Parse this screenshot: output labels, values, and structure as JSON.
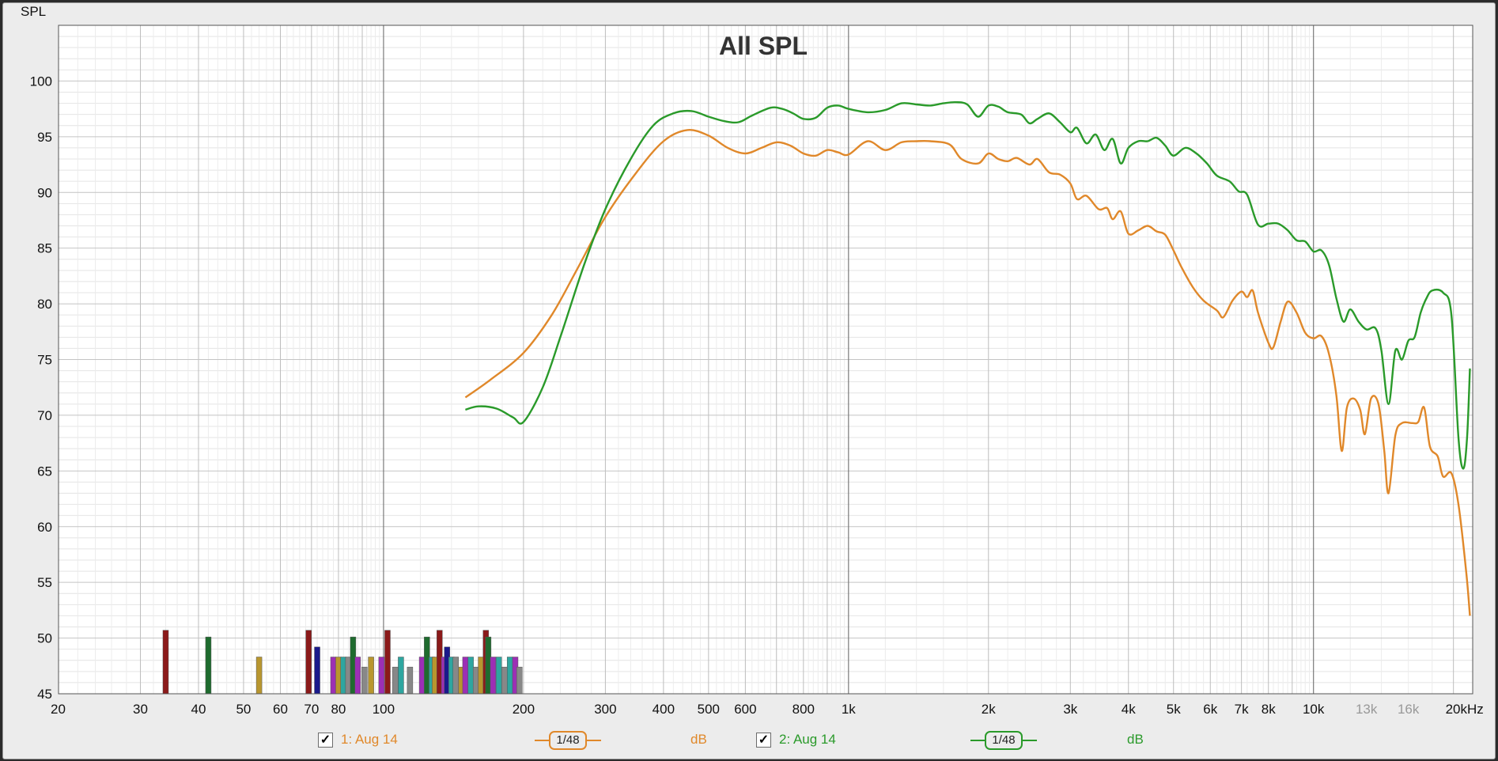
{
  "chart_data": {
    "type": "line",
    "title": "All SPL",
    "ylabel": "SPL",
    "xlabel": "",
    "xscale": "log",
    "xlim": [
      20,
      22000
    ],
    "ylim": [
      45,
      105
    ],
    "grid": true,
    "y_ticks": [
      45,
      50,
      55,
      60,
      65,
      70,
      75,
      80,
      85,
      90,
      95,
      100
    ],
    "x_ticks": [
      {
        "v": 20,
        "label": "20"
      },
      {
        "v": 30,
        "label": "30"
      },
      {
        "v": 40,
        "label": "40"
      },
      {
        "v": 50,
        "label": "50"
      },
      {
        "v": 60,
        "label": "60"
      },
      {
        "v": 70,
        "label": "70"
      },
      {
        "v": 80,
        "label": "80"
      },
      {
        "v": 100,
        "label": "100"
      },
      {
        "v": 200,
        "label": "200"
      },
      {
        "v": 300,
        "label": "300"
      },
      {
        "v": 400,
        "label": "400"
      },
      {
        "v": 500,
        "label": "500"
      },
      {
        "v": 600,
        "label": "600"
      },
      {
        "v": 800,
        "label": "800"
      },
      {
        "v": 1000,
        "label": "1k"
      },
      {
        "v": 2000,
        "label": "2k"
      },
      {
        "v": 3000,
        "label": "3k"
      },
      {
        "v": 4000,
        "label": "4k"
      },
      {
        "v": 5000,
        "label": "5k"
      },
      {
        "v": 6000,
        "label": "6k"
      },
      {
        "v": 7000,
        "label": "7k"
      },
      {
        "v": 8000,
        "label": "8k"
      },
      {
        "v": 10000,
        "label": "10k"
      },
      {
        "v": 13000,
        "label": "13k",
        "muted": true
      },
      {
        "v": 16000,
        "label": "16k",
        "muted": true
      },
      {
        "v": 20000,
        "label": "20kHz"
      }
    ],
    "series": [
      {
        "name": "1: Aug 14",
        "color": "#e0882a",
        "points": [
          [
            150,
            71.6
          ],
          [
            170,
            73.2
          ],
          [
            200,
            75.6
          ],
          [
            230,
            79
          ],
          [
            260,
            83
          ],
          [
            300,
            87.8
          ],
          [
            350,
            91.8
          ],
          [
            400,
            94.6
          ],
          [
            450,
            95.6
          ],
          [
            500,
            95.1
          ],
          [
            550,
            94
          ],
          [
            600,
            93.5
          ],
          [
            650,
            94
          ],
          [
            700,
            94.5
          ],
          [
            750,
            94.2
          ],
          [
            800,
            93.5
          ],
          [
            850,
            93.3
          ],
          [
            900,
            93.8
          ],
          [
            950,
            93.6
          ],
          [
            1000,
            93.4
          ],
          [
            1100,
            94.6
          ],
          [
            1200,
            93.8
          ],
          [
            1300,
            94.5
          ],
          [
            1400,
            94.6
          ],
          [
            1500,
            94.6
          ],
          [
            1650,
            94.3
          ],
          [
            1750,
            93
          ],
          [
            1900,
            92.6
          ],
          [
            2000,
            93.5
          ],
          [
            2100,
            93
          ],
          [
            2200,
            92.8
          ],
          [
            2300,
            93.1
          ],
          [
            2450,
            92.5
          ],
          [
            2550,
            93
          ],
          [
            2700,
            91.8
          ],
          [
            2850,
            91.6
          ],
          [
            3000,
            90.8
          ],
          [
            3100,
            89.4
          ],
          [
            3250,
            89.7
          ],
          [
            3450,
            88.5
          ],
          [
            3600,
            88.6
          ],
          [
            3700,
            87.6
          ],
          [
            3850,
            88.3
          ],
          [
            4000,
            86.3
          ],
          [
            4200,
            86.6
          ],
          [
            4400,
            87
          ],
          [
            4600,
            86.5
          ],
          [
            4800,
            86.2
          ],
          [
            5000,
            84.8
          ],
          [
            5200,
            83.3
          ],
          [
            5500,
            81.5
          ],
          [
            5800,
            80.3
          ],
          [
            6200,
            79.4
          ],
          [
            6400,
            78.8
          ],
          [
            6700,
            80.3
          ],
          [
            7000,
            81.1
          ],
          [
            7200,
            80.6
          ],
          [
            7400,
            81.2
          ],
          [
            7600,
            79.2
          ],
          [
            8000,
            76.5
          ],
          [
            8200,
            76.1
          ],
          [
            8500,
            78.4
          ],
          [
            8800,
            80.2
          ],
          [
            9200,
            79.2
          ],
          [
            9600,
            77.4
          ],
          [
            10000,
            76.9
          ],
          [
            10400,
            77.1
          ],
          [
            10800,
            75.5
          ],
          [
            11200,
            71.8
          ],
          [
            11500,
            66.8
          ],
          [
            11800,
            70.7
          ],
          [
            12200,
            71.5
          ],
          [
            12600,
            70.5
          ],
          [
            12900,
            68.3
          ],
          [
            13300,
            71.5
          ],
          [
            13800,
            71
          ],
          [
            14200,
            66.8
          ],
          [
            14500,
            63
          ],
          [
            15000,
            68.2
          ],
          [
            15500,
            69.3
          ],
          [
            16300,
            69.3
          ],
          [
            16800,
            69.4
          ],
          [
            17300,
            70.7
          ],
          [
            17800,
            67.2
          ],
          [
            18500,
            66.3
          ],
          [
            19000,
            64.5
          ],
          [
            19800,
            64.8
          ],
          [
            20500,
            62
          ],
          [
            21300,
            56
          ],
          [
            21700,
            52
          ]
        ]
      },
      {
        "name": "2: Aug 14",
        "color": "#2a9a2a",
        "points": [
          [
            150,
            70.5
          ],
          [
            160,
            70.8
          ],
          [
            175,
            70.6
          ],
          [
            190,
            69.8
          ],
          [
            200,
            69.4
          ],
          [
            220,
            72.5
          ],
          [
            240,
            77
          ],
          [
            270,
            83.5
          ],
          [
            300,
            88.5
          ],
          [
            340,
            93
          ],
          [
            380,
            96
          ],
          [
            420,
            97.1
          ],
          [
            460,
            97.3
          ],
          [
            500,
            96.8
          ],
          [
            540,
            96.4
          ],
          [
            580,
            96.3
          ],
          [
            620,
            96.9
          ],
          [
            680,
            97.6
          ],
          [
            720,
            97.5
          ],
          [
            760,
            97.1
          ],
          [
            800,
            96.6
          ],
          [
            850,
            96.7
          ],
          [
            900,
            97.6
          ],
          [
            950,
            97.8
          ],
          [
            1000,
            97.5
          ],
          [
            1100,
            97.2
          ],
          [
            1200,
            97.4
          ],
          [
            1300,
            98
          ],
          [
            1400,
            97.9
          ],
          [
            1500,
            97.8
          ],
          [
            1600,
            98
          ],
          [
            1700,
            98.1
          ],
          [
            1800,
            97.9
          ],
          [
            1900,
            96.8
          ],
          [
            2000,
            97.8
          ],
          [
            2100,
            97.7
          ],
          [
            2200,
            97.2
          ],
          [
            2350,
            97
          ],
          [
            2450,
            96.2
          ],
          [
            2550,
            96.6
          ],
          [
            2700,
            97.1
          ],
          [
            2850,
            96.3
          ],
          [
            3000,
            95.4
          ],
          [
            3100,
            95.8
          ],
          [
            3250,
            94.4
          ],
          [
            3400,
            95.2
          ],
          [
            3550,
            93.8
          ],
          [
            3700,
            94.8
          ],
          [
            3850,
            92.6
          ],
          [
            4000,
            94
          ],
          [
            4200,
            94.6
          ],
          [
            4400,
            94.6
          ],
          [
            4600,
            94.9
          ],
          [
            4800,
            94.2
          ],
          [
            5000,
            93.3
          ],
          [
            5300,
            94
          ],
          [
            5600,
            93.5
          ],
          [
            5900,
            92.6
          ],
          [
            6200,
            91.5
          ],
          [
            6600,
            91
          ],
          [
            6900,
            90.1
          ],
          [
            7200,
            89.8
          ],
          [
            7600,
            87.1
          ],
          [
            8000,
            87.2
          ],
          [
            8400,
            87.2
          ],
          [
            8800,
            86.6
          ],
          [
            9200,
            85.7
          ],
          [
            9600,
            85.6
          ],
          [
            10000,
            84.7
          ],
          [
            10400,
            84.8
          ],
          [
            10800,
            83.5
          ],
          [
            11200,
            80.5
          ],
          [
            11600,
            78.4
          ],
          [
            12000,
            79.5
          ],
          [
            12500,
            78.4
          ],
          [
            13000,
            77.7
          ],
          [
            13600,
            77.8
          ],
          [
            14000,
            75.8
          ],
          [
            14500,
            71
          ],
          [
            15000,
            75.8
          ],
          [
            15500,
            75
          ],
          [
            16000,
            76.7
          ],
          [
            16500,
            77
          ],
          [
            17000,
            79.2
          ],
          [
            17500,
            80.5
          ],
          [
            18000,
            81.2
          ],
          [
            19000,
            81
          ],
          [
            19800,
            79
          ],
          [
            20500,
            68
          ],
          [
            21000,
            65.2
          ],
          [
            21400,
            68
          ],
          [
            21700,
            74.2
          ]
        ]
      }
    ],
    "bars": [
      {
        "f": 34,
        "v": 50.7,
        "color": "#8b1a1a"
      },
      {
        "f": 42,
        "v": 50.1,
        "color": "#1e6b2e"
      },
      {
        "f": 54,
        "v": 48.3,
        "color": "#b8962e"
      },
      {
        "f": 69,
        "v": 50.7,
        "color": "#8b1a1a"
      },
      {
        "f": 72,
        "v": 49.2,
        "color": "#1a1a8b"
      },
      {
        "f": 78,
        "v": 48.3,
        "color": "#9c2fb5"
      },
      {
        "f": 80,
        "v": 48.3,
        "color": "#b8962e"
      },
      {
        "f": 82,
        "v": 48.3,
        "color": "#2ea6a0"
      },
      {
        "f": 84,
        "v": 48.3,
        "color": "#888888"
      },
      {
        "f": 86,
        "v": 50.1,
        "color": "#1e6b2e"
      },
      {
        "f": 88,
        "v": 48.3,
        "color": "#9c2fb5"
      },
      {
        "f": 91,
        "v": 47.4,
        "color": "#888888"
      },
      {
        "f": 94,
        "v": 48.3,
        "color": "#b8962e"
      },
      {
        "f": 99,
        "v": 48.3,
        "color": "#9c2fb5"
      },
      {
        "f": 102,
        "v": 50.7,
        "color": "#8b1a1a"
      },
      {
        "f": 106,
        "v": 47.4,
        "color": "#888888"
      },
      {
        "f": 109,
        "v": 48.3,
        "color": "#2ea6a0"
      },
      {
        "f": 114,
        "v": 47.4,
        "color": "#888888"
      },
      {
        "f": 121,
        "v": 48.3,
        "color": "#9c2fb5"
      },
      {
        "f": 124,
        "v": 50.1,
        "color": "#1e6b2e"
      },
      {
        "f": 127,
        "v": 48.3,
        "color": "#2ea6a0"
      },
      {
        "f": 129,
        "v": 48.3,
        "color": "#b8962e"
      },
      {
        "f": 132,
        "v": 50.7,
        "color": "#8b1a1a"
      },
      {
        "f": 135,
        "v": 48.3,
        "color": "#9c2fb5"
      },
      {
        "f": 137,
        "v": 49.2,
        "color": "#1a1a8b"
      },
      {
        "f": 140,
        "v": 48.3,
        "color": "#2ea6a0"
      },
      {
        "f": 143,
        "v": 48.3,
        "color": "#888888"
      },
      {
        "f": 147,
        "v": 47.4,
        "color": "#b8962e"
      },
      {
        "f": 150,
        "v": 48.3,
        "color": "#9c2fb5"
      },
      {
        "f": 154,
        "v": 48.3,
        "color": "#2ea6a0"
      },
      {
        "f": 158,
        "v": 47.4,
        "color": "#888888"
      },
      {
        "f": 162,
        "v": 48.3,
        "color": "#b8962e"
      },
      {
        "f": 166,
        "v": 50.7,
        "color": "#8b1a1a"
      },
      {
        "f": 168,
        "v": 50.1,
        "color": "#1e6b2e"
      },
      {
        "f": 172,
        "v": 48.3,
        "color": "#9c2fb5"
      },
      {
        "f": 177,
        "v": 48.3,
        "color": "#2ea6a0"
      },
      {
        "f": 182,
        "v": 47.4,
        "color": "#888888"
      },
      {
        "f": 187,
        "v": 48.3,
        "color": "#2ea6a0"
      },
      {
        "f": 192,
        "v": 48.3,
        "color": "#9c2fb5"
      },
      {
        "f": 196,
        "v": 47.4,
        "color": "#888888"
      }
    ]
  },
  "legend": {
    "items": [
      {
        "label": "1: Aug 14",
        "checked": "✓",
        "smoothing": "1/48",
        "unit": "dB",
        "color": "#e0882a"
      },
      {
        "label": "2: Aug 14",
        "checked": "✓",
        "smoothing": "1/48",
        "unit": "dB",
        "color": "#2a9a2a"
      }
    ]
  }
}
